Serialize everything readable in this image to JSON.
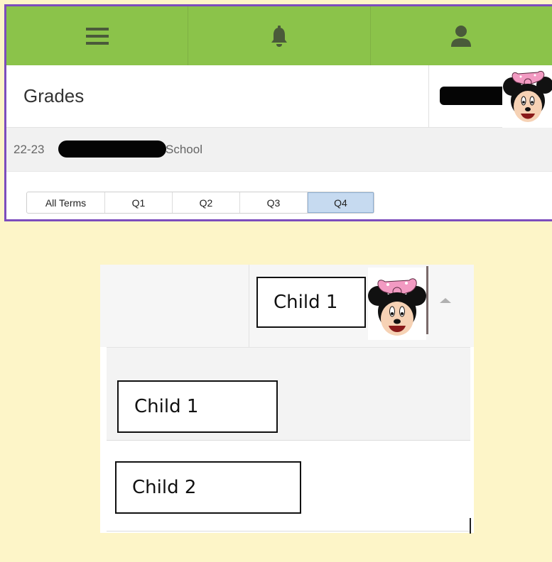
{
  "nav": {
    "menu_icon": "hamburger-menu-icon",
    "notifications_icon": "bell-icon",
    "account_icon": "user-icon"
  },
  "header": {
    "title": "Grades",
    "school_year": "22-23",
    "school_suffix": "School"
  },
  "terms": {
    "items": [
      "All Terms",
      "Q1",
      "Q2",
      "Q3",
      "Q4"
    ],
    "selected": "Q4"
  },
  "student_picker": {
    "selected_label": "Child 1",
    "options": [
      "Child 1",
      "Child 2"
    ]
  },
  "colors": {
    "nav_green": "#8bc34a",
    "accent_purple": "#7c4dbd",
    "page_background": "#fdf5c8",
    "active_tab": "#c6daf0"
  }
}
